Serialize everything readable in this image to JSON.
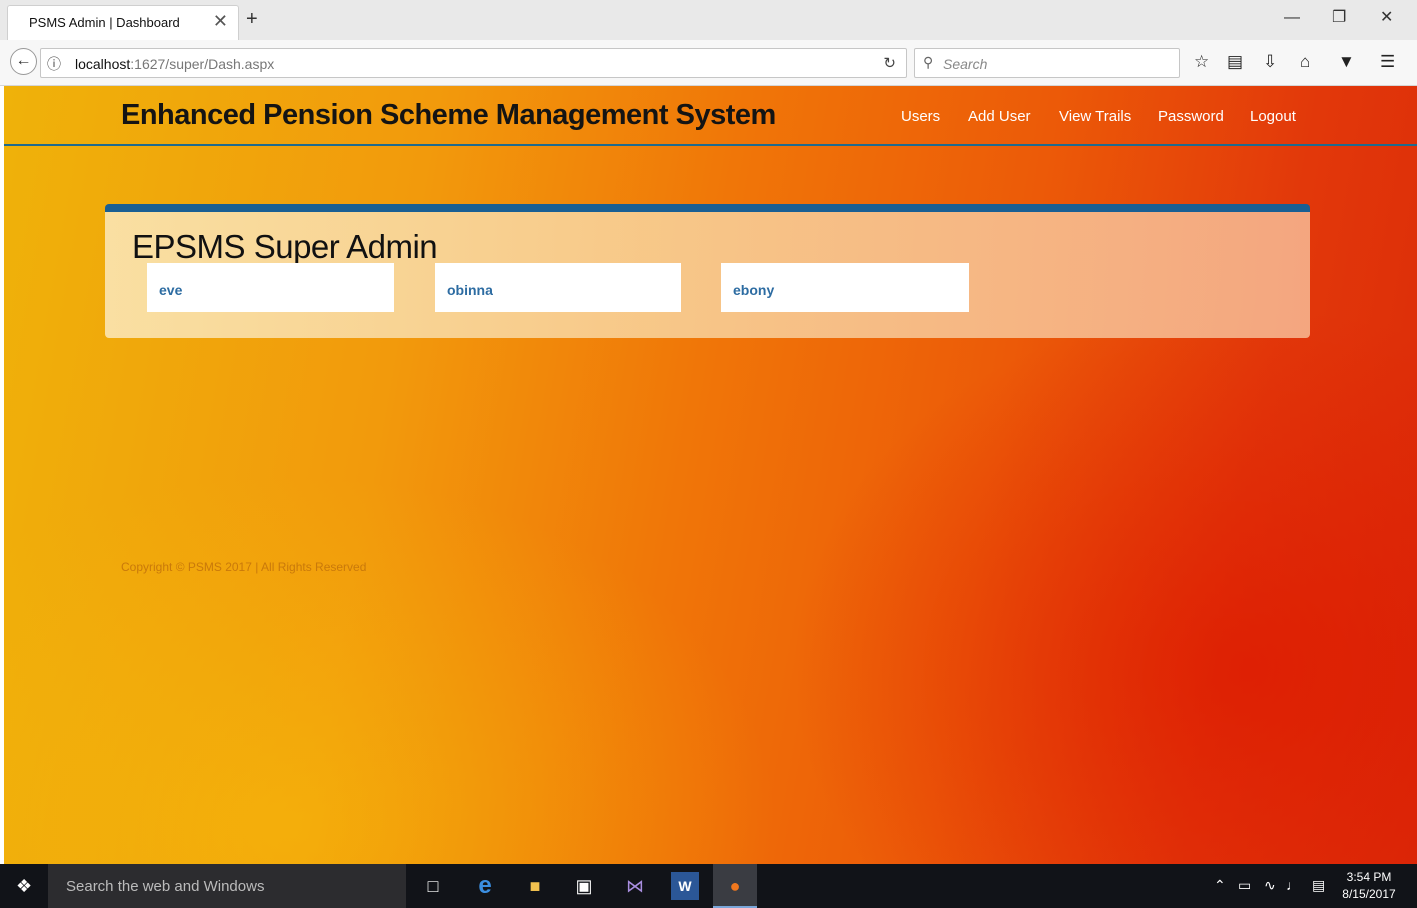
{
  "browser": {
    "tab_title": "PSMS Admin | Dashboard",
    "tab_close": "✕",
    "new_tab": "+",
    "url_host": "localhost",
    "url_rest": ":1627/super/Dash.aspx",
    "search_placeholder": "Search"
  },
  "header": {
    "brand": "Enhanced Pension Scheme Management System",
    "nav": [
      {
        "label": "Users"
      },
      {
        "label": "Add User"
      },
      {
        "label": "View Trails"
      },
      {
        "label": "Password"
      },
      {
        "label": "Logout"
      }
    ]
  },
  "panel": {
    "title": "EPSMS Super Admin",
    "users": [
      {
        "name": "eve"
      },
      {
        "name": "obinna"
      },
      {
        "name": "ebony"
      }
    ]
  },
  "footer": {
    "copyright": "Copyright © PSMS 2017 | All Rights Reserved"
  },
  "taskbar": {
    "search_placeholder": "Search the web and Windows",
    "time": "3:54 PM",
    "date": "8/15/2017"
  },
  "colors": {
    "accent": "#1a5f93",
    "link": "#2d6ca2",
    "page_start": "#efb20a",
    "page_end": "#db2a08"
  }
}
